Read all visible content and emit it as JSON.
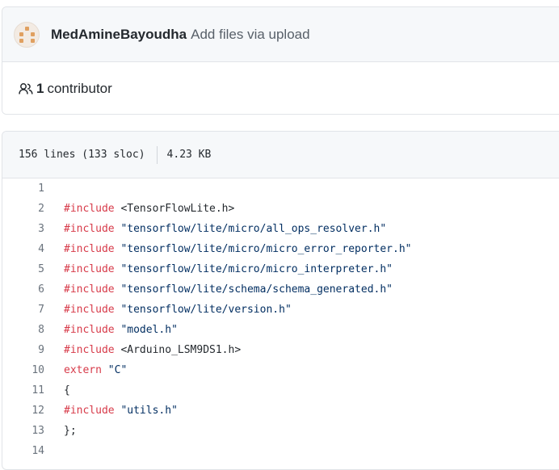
{
  "commit": {
    "author": "MedAmineBayoudha",
    "message": "Add files via upload"
  },
  "contributors": {
    "count": "1",
    "label": "contributor"
  },
  "file": {
    "lines_info": "156 lines (133 sloc)",
    "size": "4.23 KB"
  },
  "code": {
    "lines": [
      {
        "num": "1",
        "keyword": "",
        "rest": ""
      },
      {
        "num": "2",
        "keyword": "#include",
        "rest": " <TensorFlowLite.h>"
      },
      {
        "num": "3",
        "keyword": "#include",
        "rest": " \"tensorflow/lite/micro/all_ops_resolver.h\""
      },
      {
        "num": "4",
        "keyword": "#include",
        "rest": " \"tensorflow/lite/micro/micro_error_reporter.h\""
      },
      {
        "num": "5",
        "keyword": "#include",
        "rest": " \"tensorflow/lite/micro/micro_interpreter.h\""
      },
      {
        "num": "6",
        "keyword": "#include",
        "rest": " \"tensorflow/lite/schema/schema_generated.h\""
      },
      {
        "num": "7",
        "keyword": "#include",
        "rest": " \"tensorflow/lite/version.h\""
      },
      {
        "num": "8",
        "keyword": "#include",
        "rest": " \"model.h\""
      },
      {
        "num": "9",
        "keyword": "#include",
        "rest": " <Arduino_LSM9DS1.h>"
      },
      {
        "num": "10",
        "keyword": "extern",
        "rest": " \"C\""
      },
      {
        "num": "11",
        "keyword": "",
        "rest": "{"
      },
      {
        "num": "12",
        "keyword": "#include",
        "rest": " \"utils.h\""
      },
      {
        "num": "13",
        "keyword": "",
        "rest": "};"
      },
      {
        "num": "14",
        "keyword": "",
        "rest": ""
      }
    ]
  },
  "colors": {
    "keyword": "#d73a49",
    "string": "#032f62",
    "line_number": "#6a737d"
  },
  "icons": {
    "avatar": "identicon-avatar",
    "contributors": "people-icon"
  }
}
